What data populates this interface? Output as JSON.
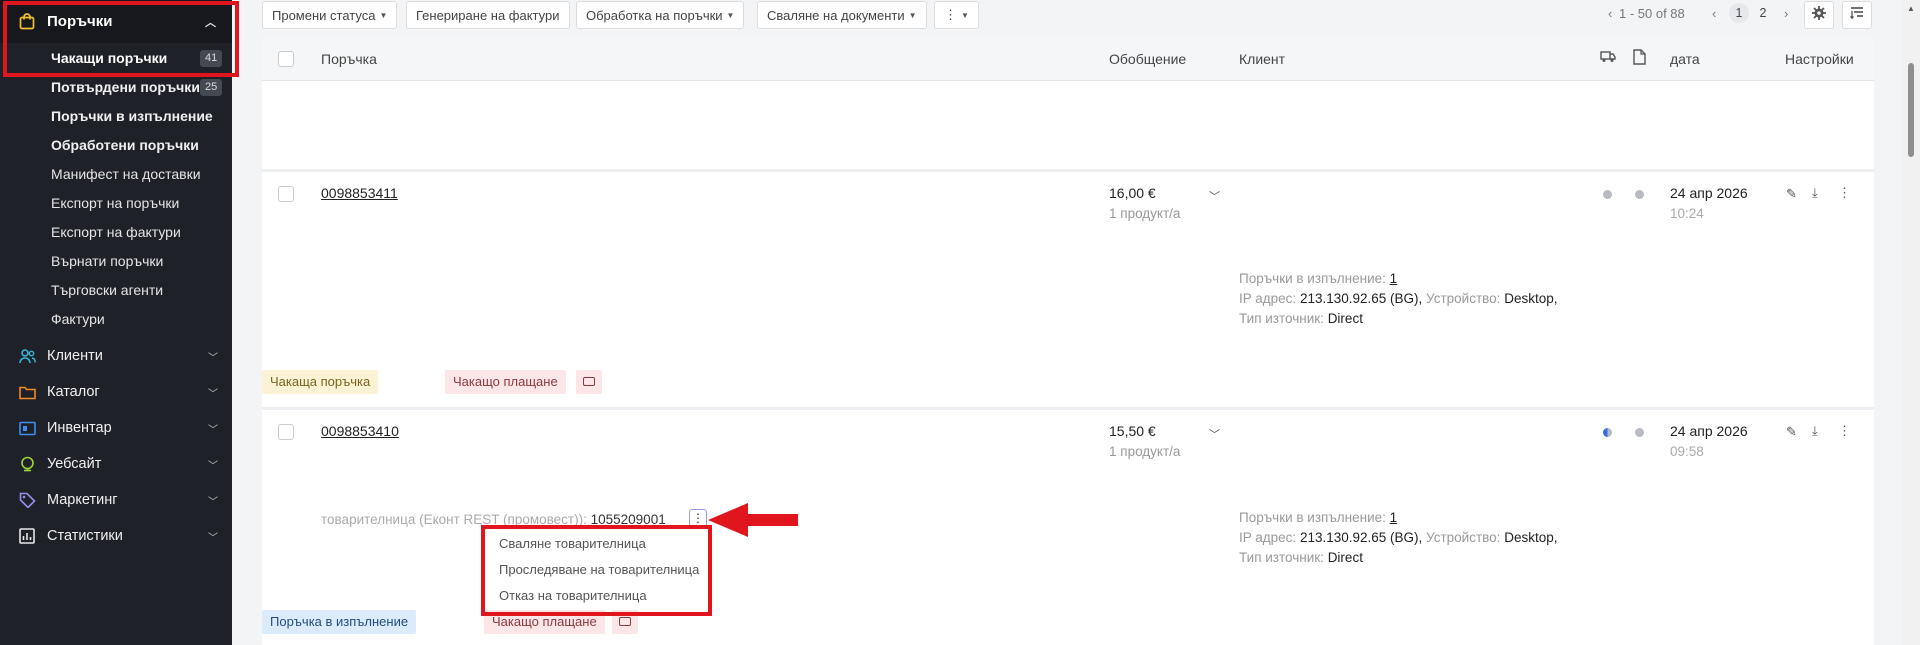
{
  "sidebar": {
    "section_title": "Поръчки",
    "sub_items": [
      {
        "label": "Чакащи поръчки",
        "count": "41"
      },
      {
        "label": "Потвърдени поръчки",
        "count": "25"
      },
      {
        "label": "Поръчки в изпълнение"
      },
      {
        "label": "Обработени поръчки"
      },
      {
        "label": "Манифест на доставки"
      },
      {
        "label": "Експорт на поръчки"
      },
      {
        "label": "Експорт на фактури"
      },
      {
        "label": "Върнати поръчки"
      },
      {
        "label": "Търговски агенти"
      },
      {
        "label": "Фактури"
      }
    ],
    "main_items": [
      {
        "label": "Клиенти",
        "icon": "users-icon"
      },
      {
        "label": "Каталог",
        "icon": "folder-icon"
      },
      {
        "label": "Инвентар",
        "icon": "inventory-icon"
      },
      {
        "label": "Уебсайт",
        "icon": "globe-icon"
      },
      {
        "label": "Маркетинг",
        "icon": "tag-icon"
      },
      {
        "label": "Статистики",
        "icon": "chart-icon"
      }
    ]
  },
  "toolbar": {
    "change_status": "Промени статуса",
    "generate_invoices": "Генериране на фактури",
    "process_orders": "Обработка на поръчки",
    "download_documents": "Сваляне на документи",
    "more": "⋮",
    "range": "1 - 50 of 88",
    "page_current": "1",
    "page_next": "2"
  },
  "table": {
    "headers": {
      "order": "Поръчка",
      "summary": "Обобщение",
      "client": "Клиент",
      "date": "дата",
      "settings": "Настройки"
    },
    "rows": [
      {
        "order_number": "0098853411",
        "total": "16,00 €",
        "products": "1 продукт/а",
        "orders_in_progress_label": "Поръчки в изпълнение:",
        "orders_in_progress_value": "1",
        "ip_label": "IP адрес:",
        "ip_value": "213.130.92.65 (BG),",
        "device_label": "Устройство:",
        "device_value": "Desktop,",
        "source_label": "Тип източник:",
        "source_value": "Direct",
        "date": "24 апр 2026",
        "time": "10:24",
        "tags": [
          "Чакаща поръчка",
          "Чакащо плащане"
        ]
      },
      {
        "order_number": "0098853410",
        "total": "15,50 €",
        "products": "1 продукт/а",
        "waybill_label": "товарителница (Еконт REST (промовест)):",
        "waybill_value": "1055209001",
        "orders_in_progress_label": "Поръчки в изпълнение:",
        "orders_in_progress_value": "1",
        "ip_label": "IP адрес:",
        "ip_value": "213.130.92.65 (BG),",
        "device_label": "Устройство:",
        "device_value": "Desktop,",
        "source_label": "Тип източник:",
        "source_value": "Direct",
        "date": "24 апр 2026",
        "time": "09:58",
        "tags": [
          "Поръчка в изпълнение",
          "Чакащо плащане"
        ]
      }
    ]
  },
  "waybill_menu": {
    "items": [
      "Сваляне товарителница",
      "Проследяване на товарителница",
      "Отказ на товарителница"
    ]
  },
  "colors": {
    "sidebar_bg": "#1e2128",
    "highlight_red": "#e0151d",
    "tag_yellow": "#fcf2d5",
    "tag_pink": "#fde6e7",
    "tag_blue": "#dcebfb"
  }
}
